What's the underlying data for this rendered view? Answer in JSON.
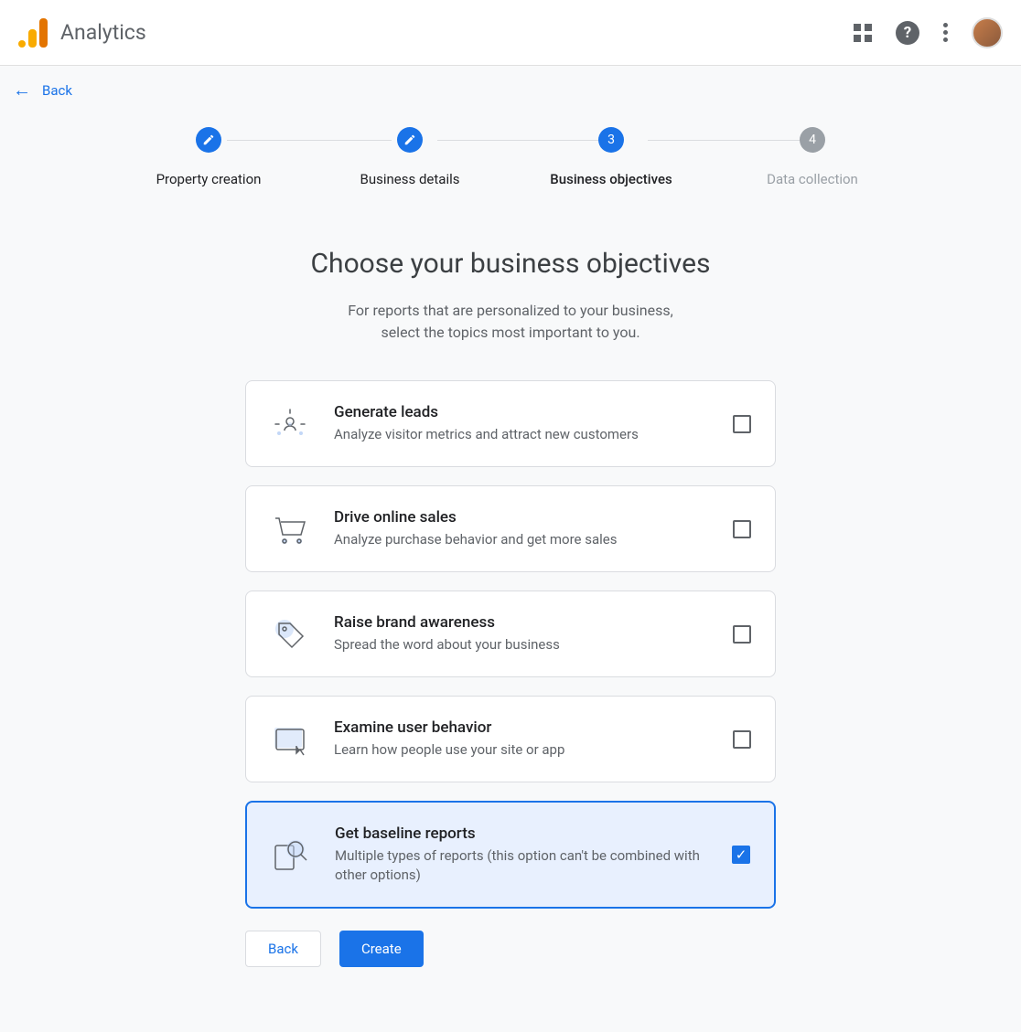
{
  "header": {
    "app_title": "Analytics"
  },
  "nav": {
    "back_label": "Back"
  },
  "stepper": {
    "steps": [
      {
        "num": "",
        "label": "Property creation",
        "state": "done"
      },
      {
        "num": "",
        "label": "Business details",
        "state": "done"
      },
      {
        "num": "3",
        "label": "Business objectives",
        "state": "active"
      },
      {
        "num": "4",
        "label": "Data collection",
        "state": "pending"
      }
    ]
  },
  "page": {
    "title": "Choose your business objectives",
    "subtitle_line1": "For reports that are personalized to your business,",
    "subtitle_line2": "select the topics most important to you."
  },
  "objectives": [
    {
      "title": "Generate leads",
      "desc": "Analyze visitor metrics and attract new customers",
      "checked": false,
      "icon": "leads-icon"
    },
    {
      "title": "Drive online sales",
      "desc": "Analyze purchase behavior and get more sales",
      "checked": false,
      "icon": "cart-icon"
    },
    {
      "title": "Raise brand awareness",
      "desc": "Spread the word about your business",
      "checked": false,
      "icon": "tag-icon"
    },
    {
      "title": "Examine user behavior",
      "desc": "Learn how people use your site or app",
      "checked": false,
      "icon": "screen-icon"
    },
    {
      "title": "Get baseline reports",
      "desc": "Multiple types of reports (this option can't be combined with other options)",
      "checked": true,
      "icon": "reports-icon"
    }
  ],
  "buttons": {
    "back": "Back",
    "create": "Create"
  }
}
